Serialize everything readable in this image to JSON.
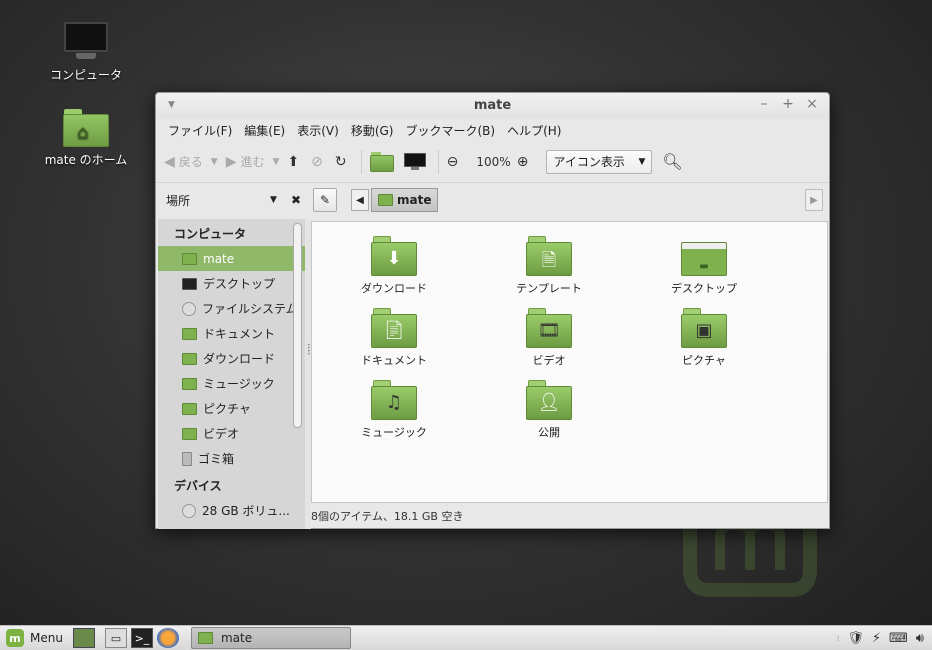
{
  "desktop": {
    "computer_label": "コンピュータ",
    "home_label": "mate のホーム"
  },
  "window": {
    "title": "mate",
    "menu": [
      "ファイル(F)",
      "編集(E)",
      "表示(V)",
      "移動(G)",
      "ブックマーク(B)",
      "ヘルプ(H)"
    ],
    "toolbar": {
      "back_label": "戻る",
      "forward_label": "進む",
      "zoom_level": "100%",
      "view_mode": "アイコン表示"
    },
    "sidebar_title": "場所",
    "breadcrumb": "mate",
    "sidebar": {
      "computer_header": "コンピュータ",
      "computer_items": [
        {
          "label": "mate",
          "icon": "home-folder-icon"
        },
        {
          "label": "デスクトップ",
          "icon": "desktop-icon"
        },
        {
          "label": "ファイルシステム",
          "icon": "drive-icon"
        },
        {
          "label": "ドキュメント",
          "icon": "documents-folder-icon"
        },
        {
          "label": "ダウンロード",
          "icon": "downloads-folder-icon"
        },
        {
          "label": "ミュージック",
          "icon": "music-folder-icon"
        },
        {
          "label": "ピクチャ",
          "icon": "pictures-folder-icon"
        },
        {
          "label": "ビデオ",
          "icon": "videos-folder-icon"
        },
        {
          "label": "ゴミ箱",
          "icon": "trash-icon"
        }
      ],
      "devices_header": "デバイス",
      "device_items": [
        {
          "label": "28 GB ボリュ...",
          "icon": "drive-icon"
        }
      ]
    },
    "files": [
      {
        "label": "ダウンロード",
        "icon": "downloads-folder-icon"
      },
      {
        "label": "テンプレート",
        "icon": "templates-folder-icon"
      },
      {
        "label": "デスクトップ",
        "icon": "desktop-folder-icon"
      },
      {
        "label": "ドキュメント",
        "icon": "documents-folder-icon"
      },
      {
        "label": "ビデオ",
        "icon": "videos-folder-icon"
      },
      {
        "label": "ピクチャ",
        "icon": "pictures-folder-icon"
      },
      {
        "label": "ミュージック",
        "icon": "music-folder-icon"
      },
      {
        "label": "公開",
        "icon": "public-folder-icon"
      }
    ],
    "status": "8個のアイテム、18.1 GB 空き"
  },
  "taskbar": {
    "menu_label": "Menu",
    "window_button": "mate"
  },
  "colors": {
    "accent": "#8fb868",
    "folder_green": "#7fb14f"
  }
}
